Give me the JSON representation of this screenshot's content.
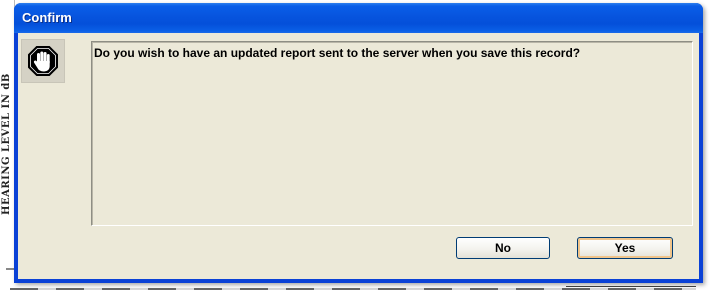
{
  "background": {
    "axis_label": "HEARING LEVEL IN dB"
  },
  "dialog": {
    "title": "Confirm",
    "icon": "stop-hand-icon",
    "message": "Do you wish to have an updated report sent to the server when you save this record?",
    "buttons": {
      "no_label": "No",
      "yes_label": "Yes"
    }
  },
  "colors": {
    "titlebar": "#0754de",
    "client_bg": "#ece9d8",
    "button_border": "#003c74"
  }
}
